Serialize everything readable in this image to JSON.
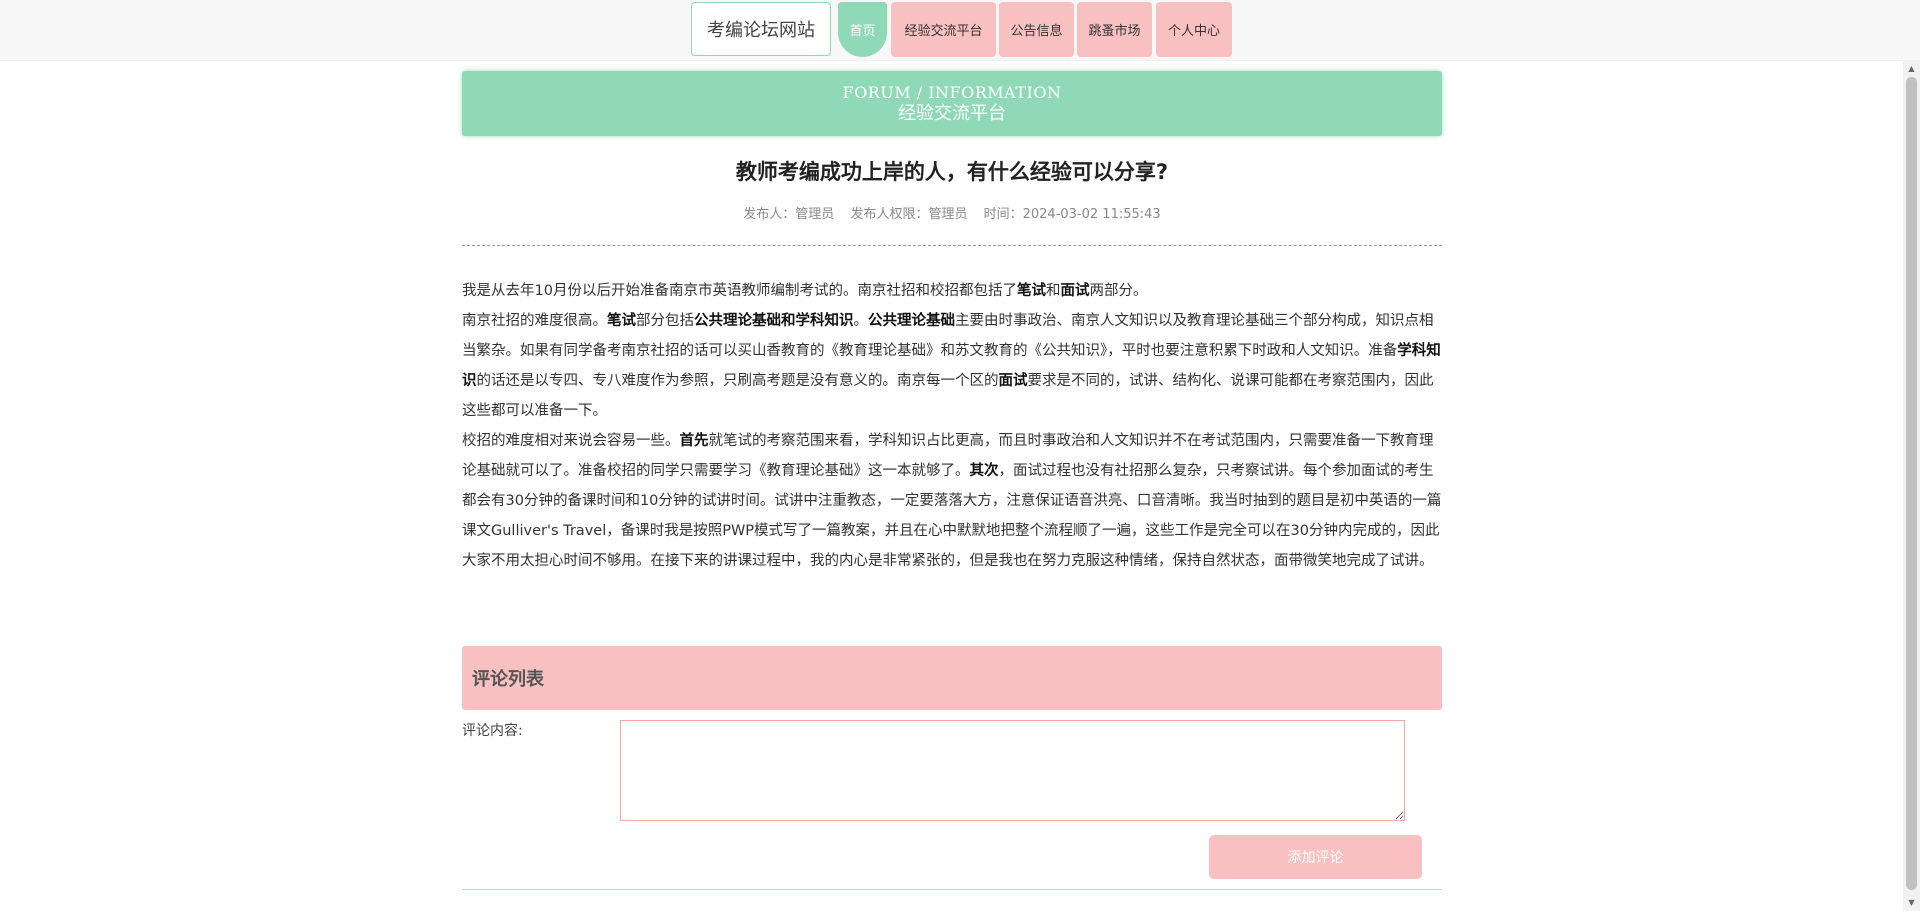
{
  "header": {
    "brand": "考编论坛网站",
    "nav": [
      {
        "label": "首页",
        "active": true
      },
      {
        "label": "经验交流平台",
        "active": false
      },
      {
        "label": "公告信息",
        "active": false
      },
      {
        "label": "跳蚤市场",
        "active": false
      },
      {
        "label": "个人中心",
        "active": false
      }
    ]
  },
  "banner": {
    "title_en": "FORUM / INFORMATION",
    "title_cn": "经验交流平台"
  },
  "post": {
    "title": "教师考编成功上岸的人，有什么经验可以分享?",
    "meta": {
      "publisher": "发布人：管理员",
      "role": "发布人权限：管理员",
      "time": "时间：2024-03-02 11:55:43"
    },
    "p1": {
      "s1": "我是从去年10月份以后开始准备南京市英语教师编制考试的。南京社招和校招都包括了",
      "b1": "笔试",
      "s2": "和",
      "b2": "面试",
      "s3": "两部分。"
    },
    "p2": {
      "s1": "南京社招的难度很高。",
      "b1": "笔试",
      "s2": "部分包括",
      "b2": "公共理论基础和学科知识",
      "s3": "。",
      "b3": "公共理论基础",
      "s4": "主要由时事政治、南京人文知识以及教育理论基础三个部分构成，知识点相当繁杂。如果有同学备考南京社招的话可以买山香教育的《教育理论基础》和苏文教育的《公共知识》，平时也要注意积累下时政和人文知识。准备",
      "b4": "学科知识",
      "s5": "的话还是以专四、专八难度作为参照，只刷高考题是没有意义的。南京每一个区的",
      "b5": "面试",
      "s6": "要求是不同的，试讲、结构化、说课可能都在考察范围内，因此这些都可以准备一下。"
    },
    "p3": {
      "s1": "校招的难度相对来说会容易一些。",
      "b1": "首先",
      "s2": "就笔试的考察范围来看，学科知识占比更高，而且时事政治和人文知识并不在考试范围内，只需要准备一下教育理论基础就可以了。准备校招的同学只需要学习《教育理论基础》这一本就够了。",
      "b2": "其次",
      "s3": "，面试过程也没有社招那么复杂，只考察试讲。每个参加面试的考生都会有30分钟的备课时间和10分钟的试讲时间。试讲中注重教态，一定要落落大方，注意保证语音洪亮、口音清晰。我当时抽到的题目是初中英语的一篇课文Gulliver's Travel，备课时我是按照PWP模式写了一篇教案，并且在心中默默地把整个流程顺了一遍，这些工作是完全可以在30分钟内完成的，因此大家不用太担心时间不够用。在接下来的讲课过程中，我的内心是非常紧张的，但是我也在努力克服这种情绪，保持自然状态，面带微笑地完成了试讲。"
    }
  },
  "comments": {
    "header": "评论列表",
    "label": "评论内容:",
    "input_value": "",
    "button": "添加评论"
  },
  "colors": {
    "accent_green": "#8fd9b6",
    "accent_pink": "#f8c0c0"
  }
}
